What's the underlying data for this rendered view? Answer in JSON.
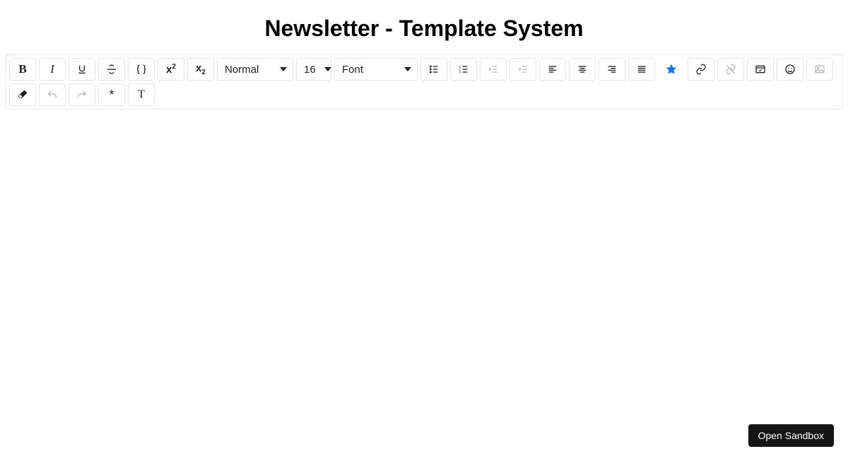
{
  "page": {
    "title": "Newsletter - Template System"
  },
  "toolbar": {
    "format": {
      "selected": "Normal"
    },
    "size": {
      "selected": "16"
    },
    "font": {
      "selected": "Font"
    }
  },
  "footer": {
    "open_sandbox": "Open Sandbox"
  }
}
